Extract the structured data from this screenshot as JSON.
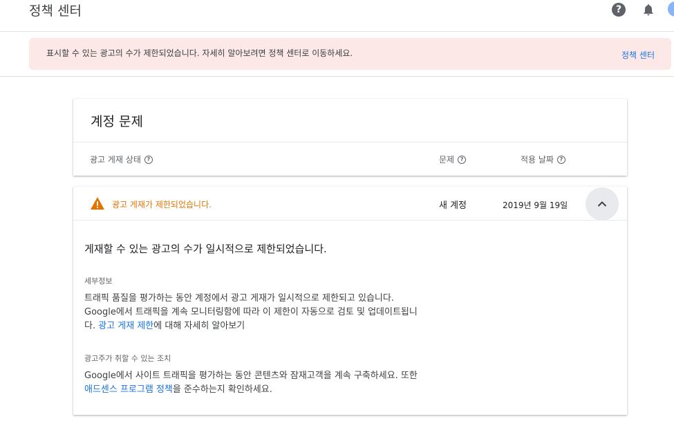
{
  "header": {
    "title": "정책 센터",
    "help_glyph": "?",
    "icons": [
      "help-icon",
      "notifications-bell-icon",
      "avatar"
    ]
  },
  "alert": {
    "message": "표시할 수 있는 광고의 수가 제한되었습니다. 자세히 알아보려면 정책 센터로 이동하세요.",
    "link": "정책 센터"
  },
  "account_issues": {
    "title": "계정 문제",
    "columns": {
      "status": "광고 게재 상태",
      "issue": "문제",
      "date": "적용 날짜"
    }
  },
  "issue_row": {
    "status": "광고 게재가 제한되었습니다.",
    "issue": "새 계정",
    "date": "2019년 9월 19일",
    "headline": "게재할 수 있는 광고의 수가 일시적으로 제한되었습니다.",
    "details_label": "세부정보",
    "details_line1": "트래픽 품질을 평가하는 동안 계정에서 광고 게재가 일시적으로 제한되고 있습니다.",
    "details_line2": "Google에서 트래픽을 계속 모니터링함에 따라 이 제한이 자동으로 검토 및 업데이트됩니",
    "details_line3_prefix": "다.",
    "details_link": "광고 게재 제한",
    "details_line3_suffix": "에 대해 자세히 알아보기",
    "actions_label": "광고주가 취할 수 있는 조치",
    "actions_line1": "Google에서 사이트 트래픽을 평가하는 동안 콘텐츠와 잠재고객을 계속 구축하세요. 또한",
    "actions_link": "애드센스 프로그램 정책",
    "actions_line2_suffix": "을 준수하는지 확인하세요."
  },
  "colors": {
    "warning": "#e37400",
    "link": "#1a73e8",
    "alert_bg": "#fce8e6"
  }
}
